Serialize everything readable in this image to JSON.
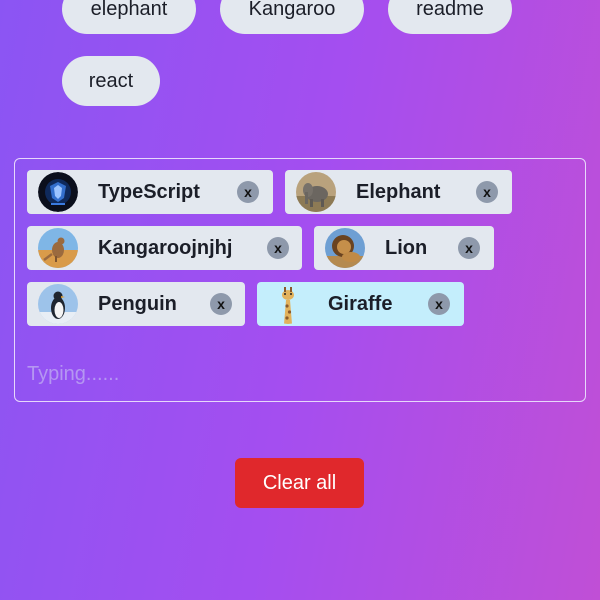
{
  "suggestions": {
    "row1": [
      "elephant",
      "Kangaroo",
      "readme"
    ],
    "row2": [
      "react"
    ]
  },
  "tags": [
    {
      "label": "TypeScript",
      "avatar": "typescript-logo-icon",
      "remove_label": "x",
      "selected": false
    },
    {
      "label": "Elephant",
      "avatar": "elephant-photo-icon",
      "remove_label": "x",
      "selected": false
    },
    {
      "label": "Kangaroojnjhj",
      "avatar": "kangaroo-photo-icon",
      "remove_label": "x",
      "selected": false
    },
    {
      "label": "Lion",
      "avatar": "lion-photo-icon",
      "remove_label": "x",
      "selected": false
    },
    {
      "label": "Penguin",
      "avatar": "penguin-photo-icon",
      "remove_label": "x",
      "selected": false
    },
    {
      "label": "Giraffe",
      "avatar": "giraffe-photo-icon",
      "remove_label": "x",
      "selected": true
    }
  ],
  "input": {
    "placeholder": "Typing......",
    "value": ""
  },
  "clear_button": {
    "label": "Clear all"
  },
  "colors": {
    "background_start": "#8b55f3",
    "background_end": "#c04fd6",
    "chip": "#e3e8ef",
    "chip_selected": "#c4eefc",
    "clear_button": "#e0282c"
  }
}
